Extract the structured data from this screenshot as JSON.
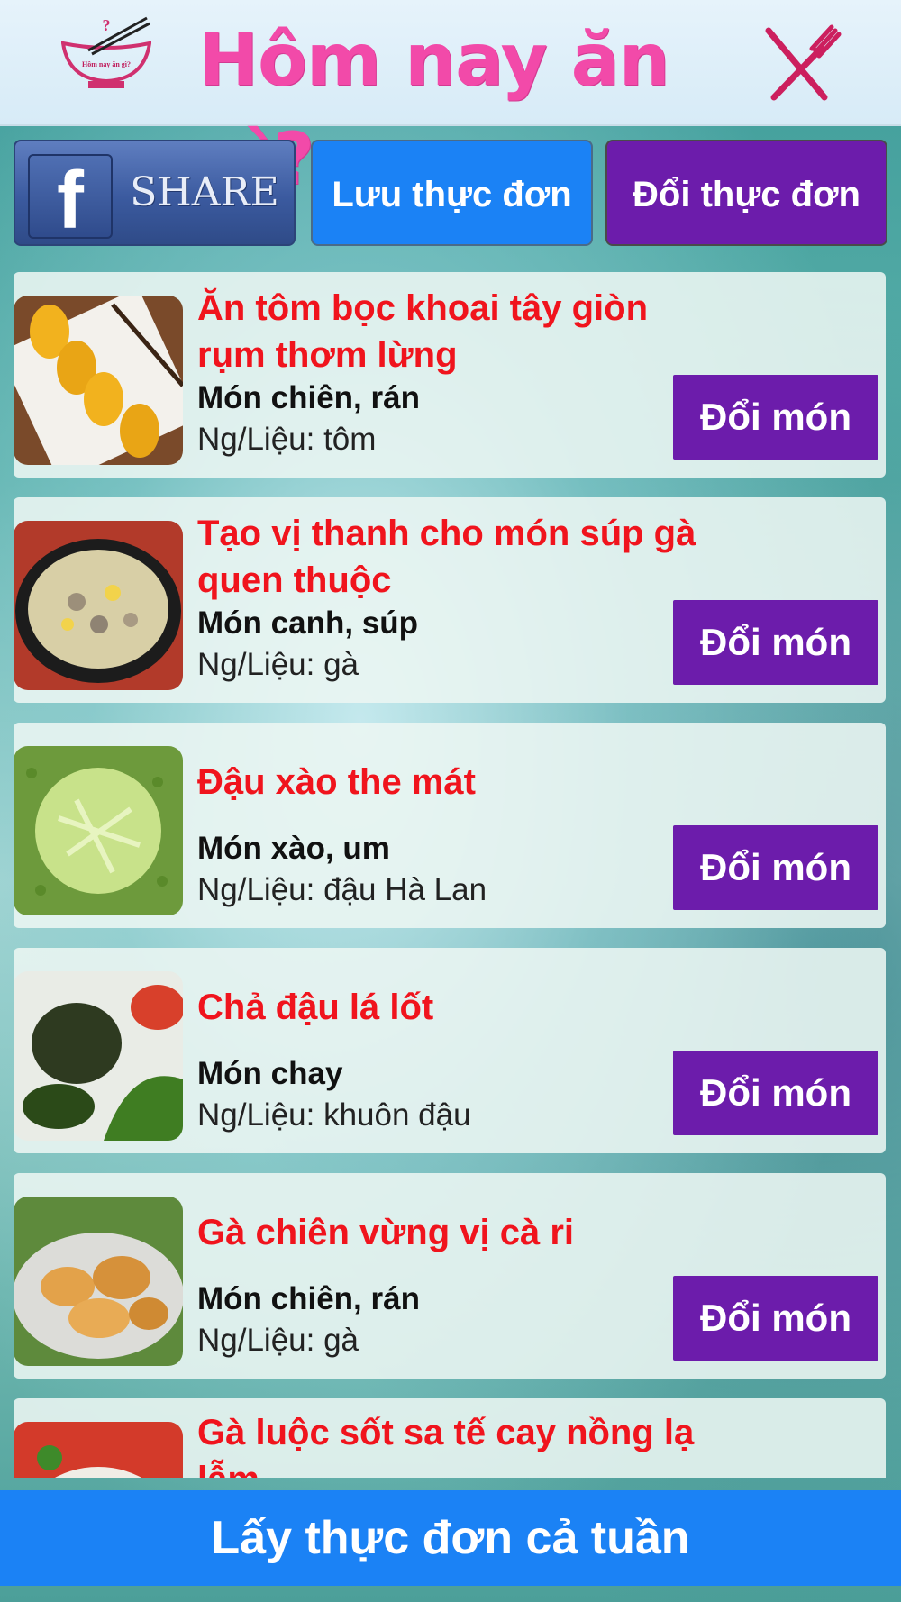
{
  "header": {
    "logo_text": "Hôm nay ăn gì?",
    "title": "Hôm nay ăn gì?",
    "close_icon": "fork-knife-cross-icon"
  },
  "toolbar": {
    "share_label": "SHARE",
    "save_label": "Lưu thực đơn",
    "change_label": "Đổi thực đơn"
  },
  "dishes": [
    {
      "title": "Ăn tôm bọc khoai tây giòn rụm thơm lừng",
      "category": "Món chiên, rán",
      "ingredient": "Ng/Liệu: tôm",
      "button": "Đổi món"
    },
    {
      "title": "Tạo vị thanh cho món súp gà quen thuộc",
      "category": "Món canh, súp",
      "ingredient": "Ng/Liệu: gà",
      "button": "Đổi món"
    },
    {
      "title": "Đậu xào the mát",
      "category": "Món xào, um",
      "ingredient": "Ng/Liệu: đậu Hà Lan",
      "button": "Đổi món"
    },
    {
      "title": "Chả đậu lá lốt",
      "category": "Món chay",
      "ingredient": "Ng/Liệu: khuôn đậu",
      "button": "Đổi món"
    },
    {
      "title": "Gà chiên vừng vị cà ri",
      "category": "Món chiên, rán",
      "ingredient": "Ng/Liệu: gà",
      "button": "Đổi món"
    },
    {
      "title": "Gà luộc sốt sa tế cay nồng lạ lẫm",
      "category": "",
      "ingredient": "",
      "button": ""
    }
  ],
  "footer": {
    "week_menu_label": "Lấy thực đơn cả tuần"
  },
  "colors": {
    "title_pink": "#f24aa9",
    "dish_red": "#f0141d",
    "purple": "#6c1cab",
    "blue": "#1b82f5"
  }
}
